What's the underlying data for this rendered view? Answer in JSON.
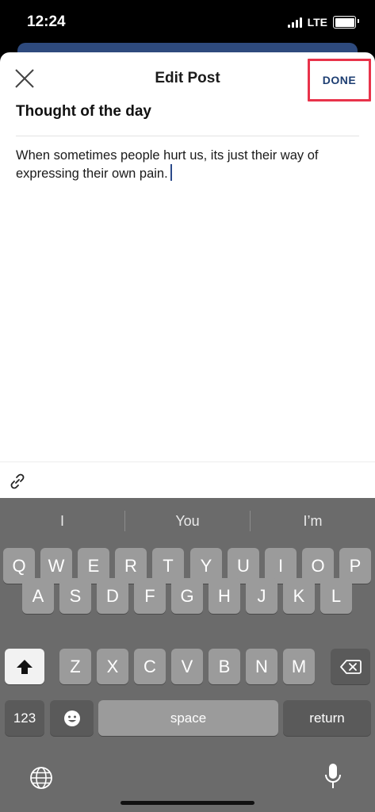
{
  "status_bar": {
    "time": "12:24",
    "network": "LTE"
  },
  "sheet": {
    "title": "Edit Post",
    "done_label": "DONE",
    "post_title": "Thought of the day",
    "post_body": "When sometimes people hurt us, its just their way of expressing their own pain."
  },
  "keyboard": {
    "suggestions": [
      "I",
      "You",
      "I’m"
    ],
    "row1": [
      "Q",
      "W",
      "E",
      "R",
      "T",
      "Y",
      "U",
      "I",
      "O",
      "P"
    ],
    "row2": [
      "A",
      "S",
      "D",
      "F",
      "G",
      "H",
      "J",
      "K",
      "L"
    ],
    "row3": [
      "Z",
      "X",
      "C",
      "V",
      "B",
      "N",
      "M"
    ],
    "numbers_label": "123",
    "space_label": "space",
    "return_label": "return"
  },
  "icons": [
    "close-icon",
    "link-icon",
    "shift-icon",
    "backspace-icon",
    "emoji-icon",
    "globe-icon",
    "microphone-icon"
  ]
}
